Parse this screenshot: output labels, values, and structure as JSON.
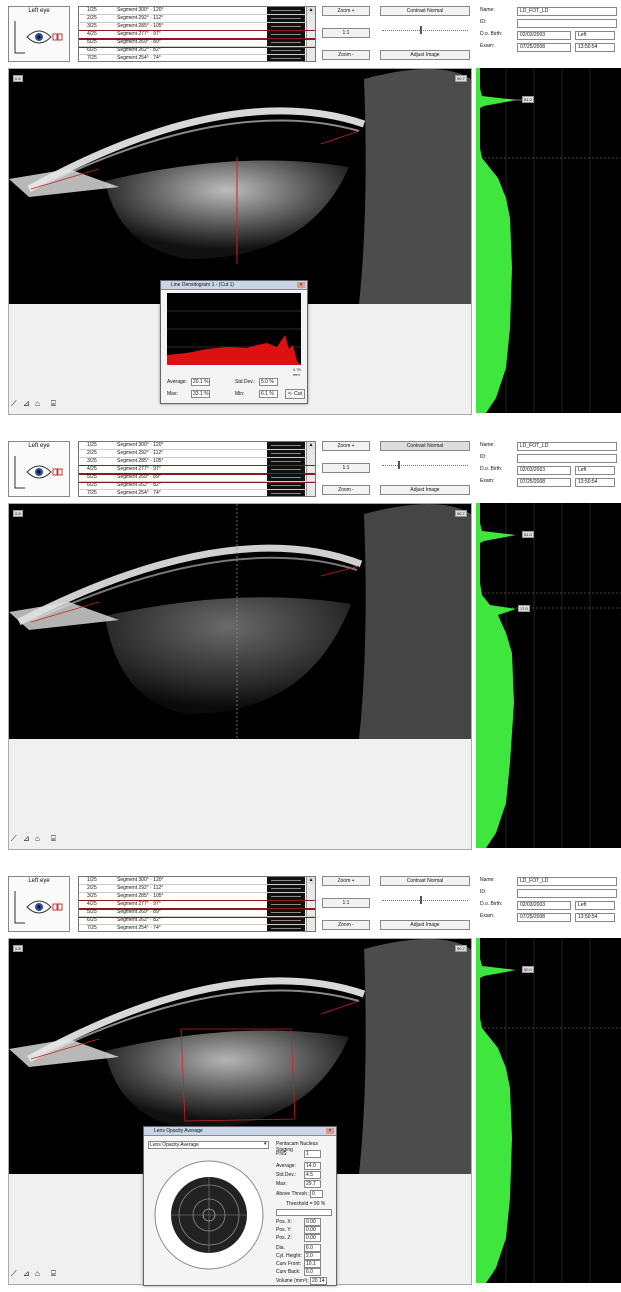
{
  "eye_label": "Left eye",
  "segments": [
    {
      "num": "1/25",
      "name": "Segment  300° · 120°"
    },
    {
      "num": "2/25",
      "name": "Segment  292° · 112°"
    },
    {
      "num": "3/25",
      "name": "Segment  285° · 105°"
    },
    {
      "num": "4/25",
      "name": "Segment  277° · 97°"
    },
    {
      "num": "5/25",
      "name": "Segment  269° · 89°"
    },
    {
      "num": "6/25",
      "name": "Segment  262° · 82°"
    },
    {
      "num": "7/25",
      "name": "Segment  254° · 74°"
    }
  ],
  "buttons": {
    "zoom_in": "Zoom +",
    "one_to_one": "1:1",
    "zoom_out": "Zoom -",
    "contrast_normal": "Contrast Normal",
    "adjust_image": "Adjust Image"
  },
  "patient": {
    "name_label": "Name:",
    "name": "LD_FOT_LD",
    "id_label": "ID:",
    "id": "",
    "dob_label": "D.o. Birth:",
    "dob": "02/03/2003",
    "side": "Left",
    "exam_label": "Exam:",
    "exam_date": "07/25/2008",
    "exam_time": "13:50:54"
  },
  "scan_tags": {
    "left": "0.8",
    "right": "90.7"
  },
  "hist_marks": {
    "p1": "51.0",
    "p2_a": "51.0",
    "p2_b": "17.0",
    "p3": "50.0"
  },
  "densitogram": {
    "title": "Line Densitogram 1 - (Cut 1)",
    "average_label": "Average:",
    "average": "20.1 %",
    "stddev_label": "Std.Dev.:",
    "stddev": "5.0 %",
    "max_label": "Max:",
    "max": "33.1 %",
    "min_label": "Min:",
    "min": "6.1 %",
    "cut_button": "<- Cut",
    "axis_right": "0.75 mm"
  },
  "pns": {
    "title": "Lens Opacity Average",
    "dropdown": "Lens Opacity Average",
    "staging_title": "Pentacam Nucleus Staging",
    "pns_label": "PNS:",
    "pns_value": "1",
    "average_label": "Average:",
    "average": "14.0",
    "stddev_label": "Std.Dev.:",
    "stddev": "4.5",
    "max_label": "Max:",
    "max": "29.7",
    "above_label": "Above Thresh.:",
    "above": "0",
    "threshold_label": "Threshold = 90 %",
    "posx_label": "Pos. X:",
    "posx": "0.00",
    "posy_label": "Pos. Y:",
    "posy": "0.00",
    "posz_label": "Pos. Z:",
    "posz": "0.00",
    "dia_label": "Dia.",
    "dia": "6.0",
    "cheight_label": "Cyl. Height:",
    "cheight": "2.0",
    "cfront_label": "Curv Front:",
    "cfront": "10.1",
    "cback_label": "Curv Back:",
    "cback": "6.0",
    "volume_label": "Volume (mm³):",
    "volume": "20.14"
  }
}
